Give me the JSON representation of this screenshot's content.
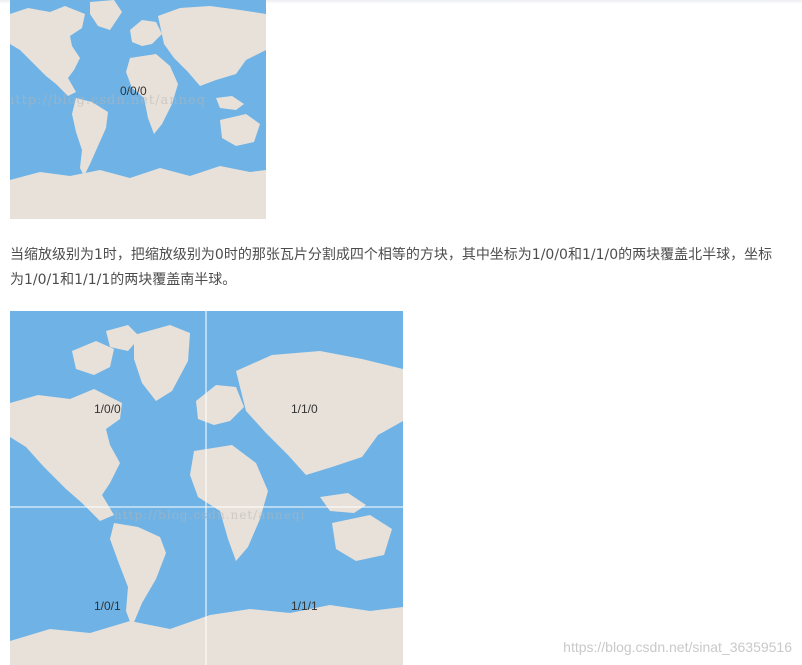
{
  "tiles": {
    "zoom0": {
      "label": "0/0/0",
      "watermark": "http://blog.csdn.net/anneq"
    },
    "zoom1": {
      "labels": [
        "1/0/0",
        "1/1/0",
        "1/0/1",
        "1/1/1"
      ],
      "watermark": "http://blog.csdn.net/anneqi"
    }
  },
  "paragraph": "当缩放级别为1时，把缩放级别为0时的那张瓦片分割成四个相等的方块，其中坐标为1/0/0和1/1/0的两块覆盖北半球，坐标为1/0/1和1/1/1的两块覆盖南半球。",
  "page_watermark": "https://blog.csdn.net/sinat_36359516",
  "colors": {
    "ocean": "#6fb3e6",
    "land": "#e8e1da",
    "text": "#4d4d4d"
  }
}
